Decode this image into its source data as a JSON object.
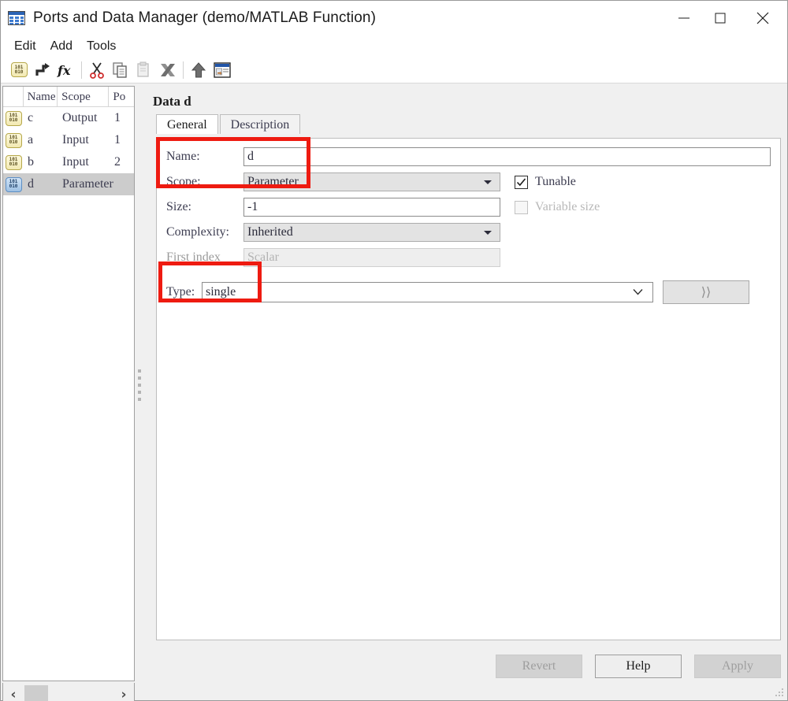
{
  "window": {
    "title": "Ports and Data Manager (demo/MATLAB Function)",
    "icon": "table-icon",
    "minimize_label": "—",
    "maximize_label": "□",
    "close_label": "✕"
  },
  "menubar": {
    "items": [
      {
        "label": "Edit"
      },
      {
        "label": "Add"
      },
      {
        "label": "Tools"
      }
    ]
  },
  "toolbar": {
    "items": [
      {
        "name": "add-data-icon",
        "glyph": "101\n010"
      },
      {
        "name": "add-event-icon",
        "glyph": ""
      },
      {
        "name": "add-function-icon",
        "glyph": "fx"
      },
      {
        "name": "cut-icon",
        "glyph": ""
      },
      {
        "name": "copy-icon",
        "glyph": ""
      },
      {
        "name": "paste-icon",
        "glyph": ""
      },
      {
        "name": "delete-icon",
        "glyph": ""
      },
      {
        "name": "move-up-icon",
        "glyph": ""
      },
      {
        "name": "open-model-explorer-icon",
        "glyph": ""
      }
    ]
  },
  "list": {
    "columns": [
      "",
      "Name",
      "Scope",
      "Po"
    ],
    "rows": [
      {
        "icon": "data-icon",
        "name": "c",
        "scope": "Output",
        "port": "1",
        "selected": false
      },
      {
        "icon": "data-icon",
        "name": "a",
        "scope": "Input",
        "port": "1",
        "selected": false
      },
      {
        "icon": "data-icon",
        "name": "b",
        "scope": "Input",
        "port": "2",
        "selected": false
      },
      {
        "icon": "data-icon",
        "name": "d",
        "scope": "Parameter",
        "port": "",
        "selected": true
      }
    ],
    "scroll_left_label": "‹",
    "scroll_right_label": "›"
  },
  "detail": {
    "heading": "Data d",
    "tabs": [
      {
        "label": "General",
        "active": true
      },
      {
        "label": "Description",
        "active": false
      }
    ],
    "fields": {
      "name": {
        "label": "Name:",
        "value": "d"
      },
      "scope": {
        "label": "Scope:",
        "value": "Parameter"
      },
      "size": {
        "label": "Size:",
        "value": "-1"
      },
      "complexity": {
        "label": "Complexity:",
        "value": "Inherited"
      },
      "first_index": {
        "label": "First index",
        "value": "Scalar",
        "disabled": true
      },
      "type": {
        "label": "Type:",
        "value": "single"
      }
    },
    "checkboxes": {
      "tunable": {
        "label": "Tunable",
        "checked": true,
        "disabled": false
      },
      "variable_size": {
        "label": "Variable size",
        "checked": false,
        "disabled": true
      }
    },
    "expand_button": {
      "label": "⟩⟩"
    }
  },
  "buttons": {
    "revert": {
      "label": "Revert",
      "enabled": false
    },
    "help": {
      "label": "Help",
      "enabled": true
    },
    "apply": {
      "label": "Apply",
      "enabled": false
    }
  },
  "colors": {
    "annotation": "#ee1b11",
    "selection": "#cccccc",
    "icon_yellow": "#f2e9b2",
    "icon_blue": "#9dc0e4"
  }
}
